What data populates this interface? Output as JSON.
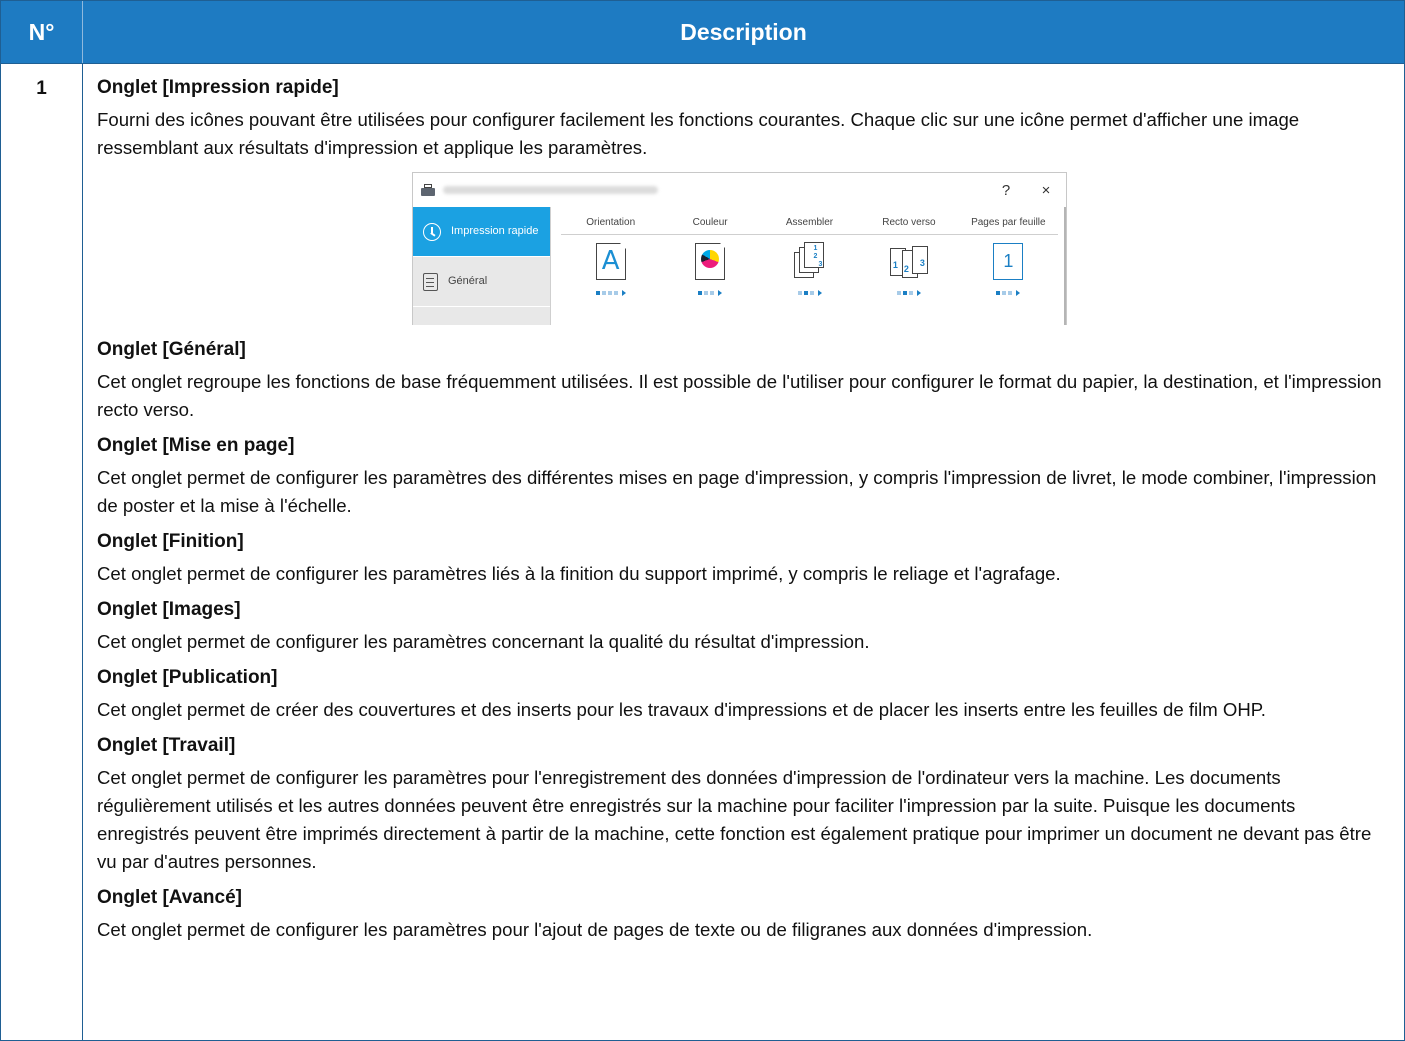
{
  "table": {
    "header": {
      "no": "N°",
      "description": "Description"
    },
    "row": {
      "number": "1",
      "sections": [
        {
          "title": "Onglet [Impression rapide]",
          "text": "Fourni des icônes pouvant être utilisées pour configurer facilement les fonctions courantes. Chaque clic sur une icône permet d'afficher une image ressemblant aux résultats d'impression et applique les paramètres."
        },
        {
          "title": "Onglet [Général]",
          "text": "Cet onglet regroupe les fonctions de base fréquemment utilisées. Il est possible de l'utiliser pour configurer le format du papier, la destination, et l'impression recto verso."
        },
        {
          "title": "Onglet [Mise en page]",
          "text": "Cet onglet permet de configurer les paramètres des différentes mises en page d'impression, y compris l'impression de livret, le mode combiner, l'impression de poster et la mise à l'échelle."
        },
        {
          "title": "Onglet [Finition]",
          "text": "Cet onglet permet de configurer les paramètres liés à la finition du support imprimé, y compris le reliage et l'agrafage."
        },
        {
          "title": "Onglet [Images]",
          "text": "Cet onglet permet de configurer les paramètres concernant la qualité du résultat d'impression."
        },
        {
          "title": "Onglet [Publication]",
          "text": "Cet onglet permet de créer des couvertures et des inserts pour les travaux d'impressions et de placer les inserts entre les feuilles de film OHP."
        },
        {
          "title": "Onglet [Travail]",
          "text": "Cet onglet permet de configurer les paramètres pour l'enregistrement des données d'impression de l'ordinateur vers la machine. Les documents régulièrement utilisés et les autres données peuvent être enregistrés sur la machine pour faciliter l'impression par la suite. Puisque les documents enregistrés peuvent être imprimés directement à partir de la machine, cette fonction est également pratique pour imprimer un document ne devant pas être vu par d'autres personnes."
        },
        {
          "title": "Onglet [Avancé]",
          "text": "Cet onglet permet de configurer les paramètres pour l'ajout de pages de texte ou de filigranes aux données d'impression."
        }
      ]
    }
  },
  "dialog": {
    "help_label": "?",
    "close_label": "×",
    "sidebar": [
      {
        "label": "Impression rapide",
        "icon": "clock-icon",
        "active": true
      },
      {
        "label": "Général",
        "icon": "document-icon",
        "active": false
      }
    ],
    "options": [
      {
        "label": "Orientation",
        "icon": "orientation-icon",
        "glyph": "A"
      },
      {
        "label": "Couleur",
        "icon": "color-icon"
      },
      {
        "label": "Assembler",
        "icon": "collate-icon"
      },
      {
        "label": "Recto verso",
        "icon": "duplex-icon"
      },
      {
        "label": "Pages par feuille",
        "icon": "pages-per-sheet-icon",
        "glyph": "1"
      }
    ],
    "colors": {
      "accent": "#1ba1e2",
      "header": "#1e7bc2"
    }
  }
}
